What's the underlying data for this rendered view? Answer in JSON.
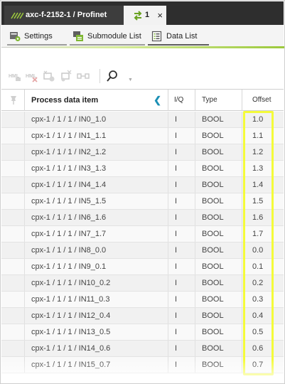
{
  "tabs": {
    "document_title": "axc-f-2152-1 / Profinet",
    "active_label": "1",
    "close_glyph": "×"
  },
  "subtabs": [
    {
      "label": "Settings",
      "icon": "settings-icon"
    },
    {
      "label": "Submodule List",
      "icon": "submodule-list-icon"
    },
    {
      "label": "Data List",
      "icon": "data-list-icon",
      "active": true
    }
  ],
  "toolbar": {
    "icons": [
      "hml-icon",
      "hml-delete-icon",
      "add-variable-icon",
      "remove-variable-icon",
      "connect-icon",
      "search-icon"
    ]
  },
  "table": {
    "headers": [
      "Process data item",
      "I/Q",
      "Type",
      "Offset"
    ],
    "rows": [
      {
        "item": "cpx-1 / 1 / 1 / IN0_1.0",
        "iq": "I",
        "type": "BOOL",
        "offset": "1.0"
      },
      {
        "item": "cpx-1 / 1 / 1 / IN1_1.1",
        "iq": "I",
        "type": "BOOL",
        "offset": "1.1"
      },
      {
        "item": "cpx-1 / 1 / 1 / IN2_1.2",
        "iq": "I",
        "type": "BOOL",
        "offset": "1.2"
      },
      {
        "item": "cpx-1 / 1 / 1 / IN3_1.3",
        "iq": "I",
        "type": "BOOL",
        "offset": "1.3"
      },
      {
        "item": "cpx-1 / 1 / 1 / IN4_1.4",
        "iq": "I",
        "type": "BOOL",
        "offset": "1.4"
      },
      {
        "item": "cpx-1 / 1 / 1 / IN5_1.5",
        "iq": "I",
        "type": "BOOL",
        "offset": "1.5"
      },
      {
        "item": "cpx-1 / 1 / 1 / IN6_1.6",
        "iq": "I",
        "type": "BOOL",
        "offset": "1.6"
      },
      {
        "item": "cpx-1 / 1 / 1 / IN7_1.7",
        "iq": "I",
        "type": "BOOL",
        "offset": "1.7"
      },
      {
        "item": "cpx-1 / 1 / 1 / IN8_0.0",
        "iq": "I",
        "type": "BOOL",
        "offset": "0.0"
      },
      {
        "item": "cpx-1 / 1 / 1 / IN9_0.1",
        "iq": "I",
        "type": "BOOL",
        "offset": "0.1"
      },
      {
        "item": "cpx-1 / 1 / 1 / IN10_0.2",
        "iq": "I",
        "type": "BOOL",
        "offset": "0.2"
      },
      {
        "item": "cpx-1 / 1 / 1 / IN11_0.3",
        "iq": "I",
        "type": "BOOL",
        "offset": "0.3"
      },
      {
        "item": "cpx-1 / 1 / 1 / IN12_0.4",
        "iq": "I",
        "type": "BOOL",
        "offset": "0.4"
      },
      {
        "item": "cpx-1 / 1 / 1 / IN13_0.5",
        "iq": "I",
        "type": "BOOL",
        "offset": "0.5"
      },
      {
        "item": "cpx-1 / 1 / 1 / IN14_0.6",
        "iq": "I",
        "type": "BOOL",
        "offset": "0.6"
      },
      {
        "item": "cpx-1 / 1 / 1 / IN15_0.7",
        "iq": "I",
        "type": "BOOL",
        "offset": "0.7"
      }
    ]
  },
  "colors": {
    "tabbar_bg": "#2e2e2e",
    "accent_green": "#9cc93c",
    "highlight": "#f4fb3a",
    "collapse_arrow": "#1a8fb4"
  }
}
